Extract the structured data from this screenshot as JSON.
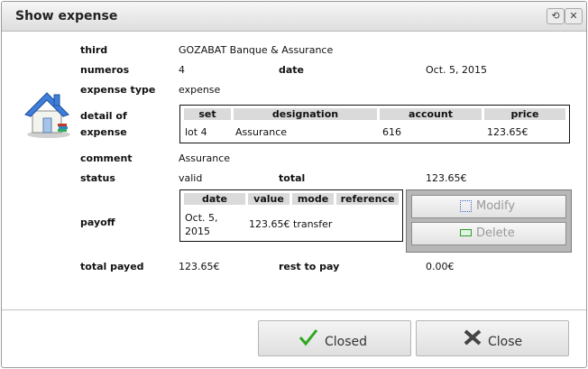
{
  "dialog": {
    "title": "Show expense",
    "restore_icon": "⟲",
    "close_icon": "✕"
  },
  "fields": {
    "third": {
      "label": "third",
      "value": "GOZABAT Banque & Assurance"
    },
    "numeros": {
      "label": "numeros",
      "value": "4"
    },
    "date": {
      "label": "date",
      "value": "Oct. 5, 2015"
    },
    "expense_type": {
      "label": "expense type",
      "value": "expense"
    },
    "detail": {
      "label_line1": "detail of",
      "label_line2": "expense"
    },
    "comment": {
      "label": "comment",
      "value": "Assurance"
    },
    "status": {
      "label": "status",
      "value": "valid"
    },
    "total": {
      "label": "total",
      "value": "123.65€"
    },
    "payoff": {
      "label": "payoff"
    },
    "total_payed": {
      "label": "total payed",
      "value": "123.65€"
    },
    "rest_to_pay": {
      "label": "rest to pay",
      "value": "0.00€"
    }
  },
  "detail_table": {
    "columns": [
      "set",
      "designation",
      "account",
      "price"
    ],
    "rows": [
      [
        "lot 4",
        "Assurance",
        "616",
        "123.65€"
      ]
    ]
  },
  "payoff_table": {
    "columns": [
      "date",
      "value",
      "mode",
      "reference"
    ],
    "rows": [
      {
        "date_line1": "Oct. 5,",
        "date_line2": "2015",
        "value": "123.65€",
        "mode": "transfer",
        "reference": ""
      }
    ]
  },
  "payoff_actions": {
    "modify_label": "Modify",
    "delete_label": "Delete"
  },
  "footer": {
    "closed_label": "Closed",
    "close_label": "Close"
  },
  "colors": {
    "check_green": "#2ea71f",
    "button_panel": "#b7b7b7"
  }
}
